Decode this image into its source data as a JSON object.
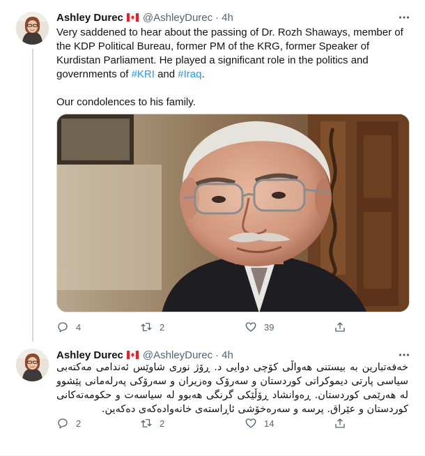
{
  "tweets": [
    {
      "author": {
        "display_name": "Ashley Durec",
        "handle": "@AshleyDurec",
        "flag": "canada-flag"
      },
      "time": "4h",
      "text_line1": "Very saddened to hear about the passing of Dr. Rozh Shaways, member of the KDP Political Bureau, former PM of the KRG, former Speaker of Kurdistan Parliament. He played a significant role in the politics and governments of ",
      "hashtag1": "#KRI",
      "and_text": " and ",
      "hashtag2": "#Iraq",
      "period": ".",
      "text_line2": "Our condolences to his family.",
      "actions": {
        "replies": "4",
        "retweets": "2",
        "likes": "39"
      }
    },
    {
      "author": {
        "display_name": "Ashley Durec",
        "handle": "@AshleyDurec",
        "flag": "canada-flag"
      },
      "time": "4h",
      "text": "خەفەتبارین بە بیستنی هەواڵی کۆچی دوایی د. ڕۆژ نوری شاوێس ئەندامی مەکتەبی سیاسی پارتی دیموکراتی کوردستان و سەرۆک وەزیران و سەرۆکی پەرلەمانی پێشوو لە هەرێمی کوردستان. ڕەوانشاد ڕۆڵێکی گرنگی هەبوو لە سیاسەت و حکومەتەکانی کوردستان و عێراق. پرسە و سەرەخۆشی ئاڕاستەی خانەوادەکەی دەکەین.",
      "actions": {
        "replies": "2",
        "retweets": "2",
        "likes": "14"
      }
    }
  ],
  "icons": [
    "more-icon",
    "reply-icon",
    "retweet-icon",
    "like-icon",
    "share-icon"
  ],
  "colors": {
    "link": "#1d9bf0",
    "secondary": "#536471",
    "thread_line": "#cfd9de",
    "text": "#0f1419"
  }
}
